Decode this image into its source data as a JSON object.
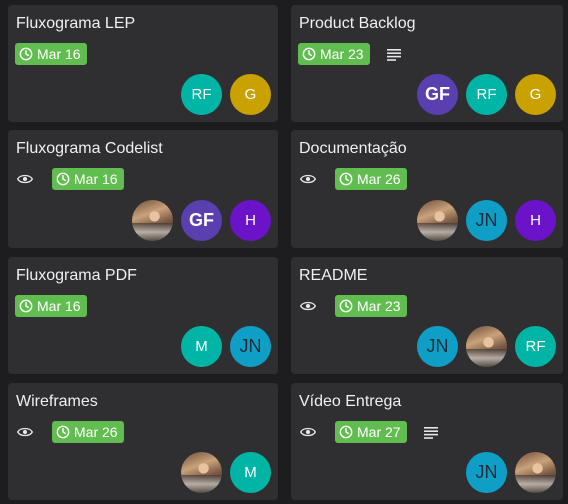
{
  "cards": [
    {
      "id": "c1",
      "title": "Fluxograma LEP",
      "due": "Mar 16",
      "watching": false,
      "has_description": false,
      "members": [
        {
          "type": "initials",
          "text": "RF",
          "color": "#00b5a6"
        },
        {
          "type": "initials",
          "text": "G",
          "color": "#c9a100"
        }
      ]
    },
    {
      "id": "c2",
      "title": "Product Backlog",
      "due": "Mar 23",
      "watching": false,
      "has_description": true,
      "members": [
        {
          "type": "initials",
          "text": "GF",
          "color": "#5a3fb0"
        },
        {
          "type": "initials",
          "text": "RF",
          "color": "#00b5a6"
        },
        {
          "type": "initials",
          "text": "G",
          "color": "#c9a100"
        }
      ]
    },
    {
      "id": "c3",
      "title": "Fluxograma Codelist",
      "due": "Mar 16",
      "watching": true,
      "has_description": false,
      "members": [
        {
          "type": "photo",
          "text": ""
        },
        {
          "type": "initials",
          "text": "GF",
          "color": "#5a3fb0"
        },
        {
          "type": "initials",
          "text": "H",
          "color": "#6b13c9"
        }
      ]
    },
    {
      "id": "c4",
      "title": "Documentação",
      "due": "Mar 26",
      "watching": true,
      "has_description": false,
      "members": [
        {
          "type": "photo",
          "text": ""
        },
        {
          "type": "initials",
          "text": "JN",
          "color": "#0f9fc6"
        },
        {
          "type": "initials",
          "text": "H",
          "color": "#6b13c9"
        }
      ]
    },
    {
      "id": "c5",
      "title": "Fluxograma PDF",
      "due": "Mar 16",
      "watching": false,
      "has_description": false,
      "members": [
        {
          "type": "initials",
          "text": "M",
          "color": "#00b5a6"
        },
        {
          "type": "initials",
          "text": "JN",
          "color": "#0f9fc6"
        }
      ]
    },
    {
      "id": "c6",
      "title": "README",
      "due": "Mar 23",
      "watching": true,
      "has_description": false,
      "members": [
        {
          "type": "initials",
          "text": "JN",
          "color": "#0f9fc6"
        },
        {
          "type": "photo",
          "text": ""
        },
        {
          "type": "initials",
          "text": "RF",
          "color": "#00b5a6"
        }
      ]
    },
    {
      "id": "c7",
      "title": "Wireframes",
      "due": "Mar 26",
      "watching": true,
      "has_description": false,
      "members": [
        {
          "type": "photo",
          "text": ""
        },
        {
          "type": "initials",
          "text": "M",
          "color": "#00b5a6"
        }
      ]
    },
    {
      "id": "c8",
      "title": "Vídeo Entrega",
      "due": "Mar 27",
      "watching": true,
      "has_description": true,
      "members": [
        {
          "type": "initials",
          "text": "JN",
          "color": "#0f9fc6"
        },
        {
          "type": "photo",
          "text": ""
        }
      ]
    }
  ],
  "icons": {
    "eye": "eye-icon",
    "clock": "clock-icon",
    "description": "description-icon"
  },
  "colors": {
    "due_badge": "#61bd4f",
    "card_bg": "#2f2f31",
    "board_bg": "#1d1d1f"
  }
}
